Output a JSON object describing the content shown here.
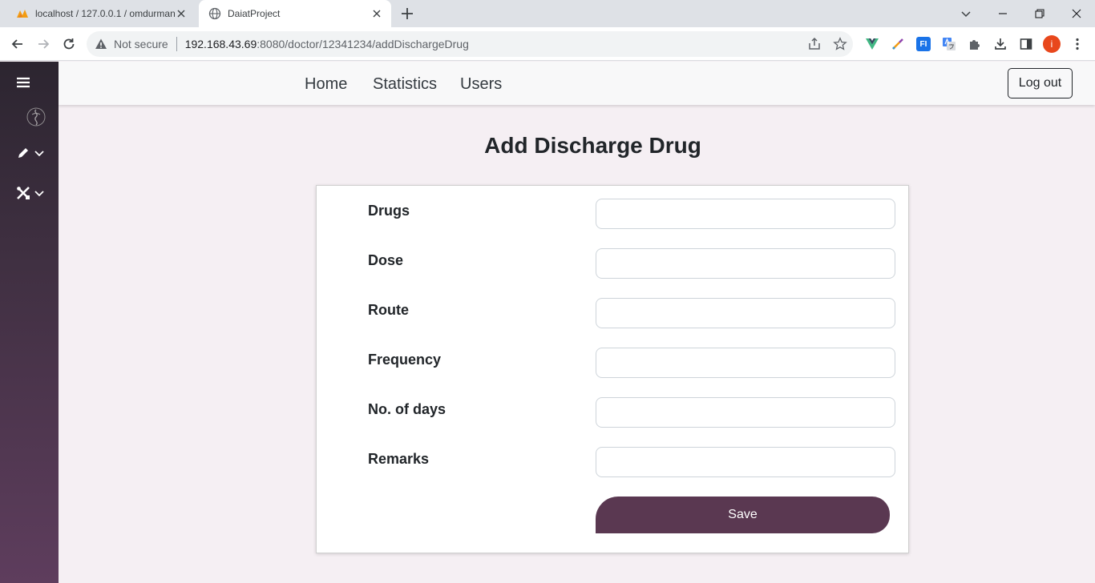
{
  "browser": {
    "tabs": [
      {
        "title": "localhost / 127.0.0.1 / omdurman",
        "favicon": "phpmyadmin-icon",
        "active": false
      },
      {
        "title": "DaiatProject",
        "favicon": "globe-icon",
        "active": true
      }
    ],
    "address": {
      "security_label": "Not secure",
      "host": "192.168.43.69",
      "path": ":8080/doctor/12341234/addDischargeDrug"
    },
    "profile_initial": "i",
    "extensions": [
      "vue-devtools-icon",
      "color-picker-icon",
      "translate-ext-icon",
      "google-translate-icon",
      "puzzle-icon"
    ]
  },
  "sidebar": {
    "menu_icon": "hamburger-icon",
    "logo": "logo-icon",
    "items": [
      {
        "icon": "pencil-icon",
        "chevron": "chevron-down-icon"
      },
      {
        "icon": "tools-icon",
        "chevron": "chevron-down-icon"
      }
    ]
  },
  "nav": {
    "links": [
      "Home",
      "Statistics",
      "Users"
    ],
    "logout_label": "Log out"
  },
  "page": {
    "title": "Add Discharge Drug"
  },
  "form": {
    "fields": [
      {
        "label": "Drugs",
        "value": ""
      },
      {
        "label": "Dose",
        "value": ""
      },
      {
        "label": "Route",
        "value": ""
      },
      {
        "label": "Frequency",
        "value": ""
      },
      {
        "label": "No. of days",
        "value": ""
      },
      {
        "label": "Remarks",
        "value": ""
      }
    ],
    "submit_label": "Save"
  },
  "colors": {
    "sidebar_top": "#2c2530",
    "sidebar_bottom": "#5e3d5d",
    "accent": "#5a3851",
    "page_bg": "#f5eff3"
  }
}
